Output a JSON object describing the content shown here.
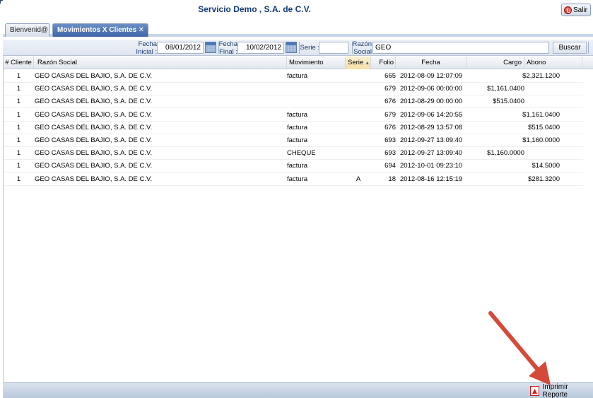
{
  "header": {
    "title": "Servicio Demo , S.A. de C.V.",
    "salir_label": "Salir"
  },
  "tabs": [
    {
      "label": "Bienvenid@"
    },
    {
      "label": "Movimientos X Clientes"
    }
  ],
  "filters": {
    "fecha_inicial_label_1": "Fecha",
    "fecha_inicial_label_2": "Inicial :",
    "fecha_inicial_value": "08/01/2012",
    "fecha_final_label_1": "Fecha",
    "fecha_final_label_2": "Final :",
    "fecha_final_value": "10/02/2012",
    "serie_label": "Serie :",
    "serie_value": "",
    "razon_label_1": "Razón",
    "razon_label_2": "Social :",
    "razon_value": "GEO",
    "buscar_label": "Buscar"
  },
  "grid": {
    "columns": [
      "# Cliente",
      "Razón Social",
      "Movimiento",
      "Serie",
      "Folio",
      "Fecha",
      "Cargo",
      "Abono"
    ],
    "sorted_column": "Serie",
    "rows": [
      {
        "cliente": "1",
        "razon": "GEO CASAS DEL BAJIO, S.A. DE C.V.",
        "movimiento": "factura",
        "serie": "",
        "folio": "665",
        "fecha": "2012-08-09 12:07:09",
        "cargo": "",
        "abono": "$2,321.1200"
      },
      {
        "cliente": "1",
        "razon": "GEO CASAS DEL BAJIO, S.A. DE C.V.",
        "movimiento": "",
        "serie": "",
        "folio": "679",
        "fecha": "2012-09-06 00:00:00",
        "cargo": "$1,161.0400",
        "abono": ""
      },
      {
        "cliente": "1",
        "razon": "GEO CASAS DEL BAJIO, S.A. DE C.V.",
        "movimiento": "",
        "serie": "",
        "folio": "676",
        "fecha": "2012-08-29 00:00:00",
        "cargo": "$515.0400",
        "abono": ""
      },
      {
        "cliente": "1",
        "razon": "GEO CASAS DEL BAJIO, S.A. DE C.V.",
        "movimiento": "factura",
        "serie": "",
        "folio": "679",
        "fecha": "2012-09-06 14:20:55",
        "cargo": "",
        "abono": "$1,161.0400"
      },
      {
        "cliente": "1",
        "razon": "GEO CASAS DEL BAJIO, S.A. DE C.V.",
        "movimiento": "factura",
        "serie": "",
        "folio": "676",
        "fecha": "2012-08-29 13:57:08",
        "cargo": "",
        "abono": "$515.0400"
      },
      {
        "cliente": "1",
        "razon": "GEO CASAS DEL BAJIO, S.A. DE C.V.",
        "movimiento": "factura",
        "serie": "",
        "folio": "693",
        "fecha": "2012-09-27 13:09:40",
        "cargo": "",
        "abono": "$1,160.0000"
      },
      {
        "cliente": "1",
        "razon": "GEO CASAS DEL BAJIO, S.A. DE C.V.",
        "movimiento": "CHEQUE",
        "serie": "",
        "folio": "693",
        "fecha": "2012-09-27 13:09:40",
        "cargo": "$1,160.0000",
        "abono": ""
      },
      {
        "cliente": "1",
        "razon": "GEO CASAS DEL BAJIO, S.A. DE C.V.",
        "movimiento": "factura",
        "serie": "",
        "folio": "694",
        "fecha": "2012-10-01 09:23:10",
        "cargo": "",
        "abono": "$14.5000"
      },
      {
        "cliente": "1",
        "razon": "GEO CASAS DEL BAJIO, S.A. DE C.V.",
        "movimiento": "factura",
        "serie": "A",
        "folio": "18",
        "fecha": "2012-08-16 12:15:19",
        "cargo": "",
        "abono": "$281.3200"
      }
    ]
  },
  "footer": {
    "print_label": "Imprimir Reporte"
  },
  "colors": {
    "title": "#153a7a",
    "active_tab": "#4a72b0",
    "sorted_header": "#f7dfa6",
    "annotation_arrow": "#d44a3a"
  }
}
